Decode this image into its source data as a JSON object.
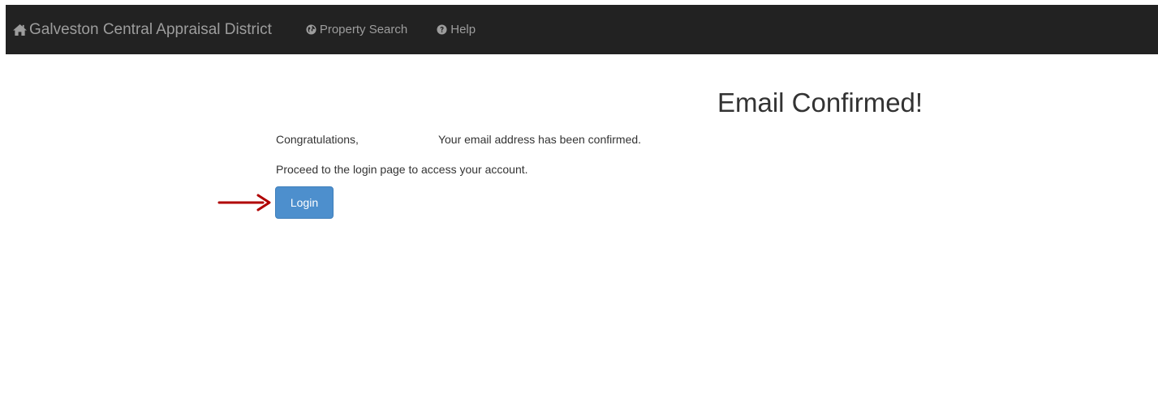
{
  "navbar": {
    "brand": "Galveston Central Appraisal District",
    "links": [
      {
        "label": "Property Search",
        "icon": "globe-icon"
      },
      {
        "label": "Help",
        "icon": "question-circle-icon"
      }
    ],
    "background": "#222222",
    "text_color": "#9d9d9d"
  },
  "main": {
    "title": "Email Confirmed!",
    "congrats": "Congratulations,",
    "confirmed_message": "Your email address has been confirmed.",
    "instruction": "Proceed to the login page to access your account.",
    "login_label": "Login",
    "accent_color": "#4d8fcd",
    "arrow_color": "#b00000"
  }
}
